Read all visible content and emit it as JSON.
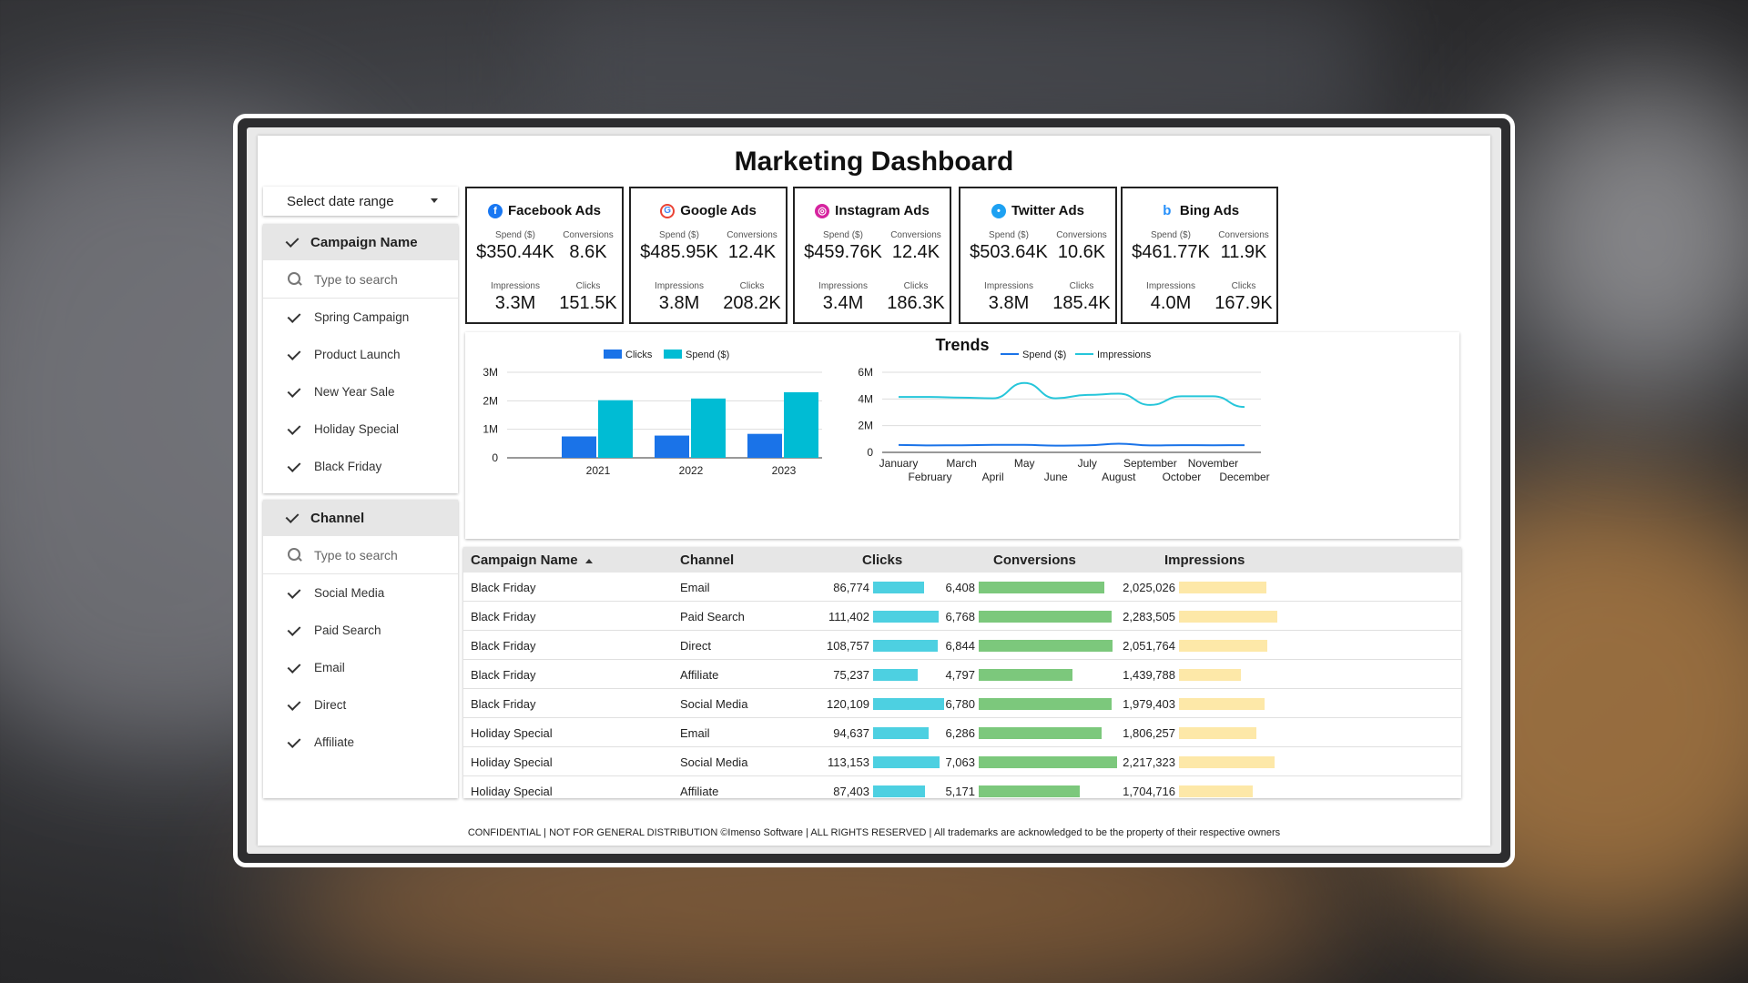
{
  "page_title": "Marketing Dashboard",
  "date_range": {
    "label": "Select date range"
  },
  "filters": {
    "campaign": {
      "title": "Campaign Name",
      "search_placeholder": "Type to search",
      "items": [
        "Spring Campaign",
        "Product Launch",
        "New Year Sale",
        "Holiday Special",
        "Black Friday"
      ]
    },
    "channel": {
      "title": "Channel",
      "search_placeholder": "Type to search",
      "items": [
        "Social Media",
        "Paid Search",
        "Email",
        "Direct",
        "Affiliate"
      ]
    }
  },
  "kpis": [
    {
      "name": "Facebook Ads",
      "icon": "facebook-icon",
      "color": "#1877f2",
      "spend_label": "Spend ($)",
      "spend": "$350.44K",
      "conv_label": "Conversions",
      "conversions": "8.6K",
      "imp_label": "Impressions",
      "impressions": "3.3M",
      "clicks_label": "Clicks",
      "clicks": "151.5K"
    },
    {
      "name": "Google Ads",
      "icon": "google-icon",
      "color": "#4285f4",
      "spend_label": "Spend ($)",
      "spend": "$485.95K",
      "conv_label": "Conversions",
      "conversions": "12.4K",
      "imp_label": "Impressions",
      "impressions": "3.8M",
      "clicks_label": "Clicks",
      "clicks": "208.2K"
    },
    {
      "name": "Instagram Ads",
      "icon": "instagram-icon",
      "color": "#d6249f",
      "spend_label": "Spend ($)",
      "spend": "$459.76K",
      "conv_label": "Conversions",
      "conversions": "12.4K",
      "imp_label": "Impressions",
      "impressions": "3.4M",
      "clicks_label": "Clicks",
      "clicks": "186.3K"
    },
    {
      "name": "Twitter Ads",
      "icon": "twitter-icon",
      "color": "#1da1f2",
      "spend_label": "Spend ($)",
      "spend": "$503.64K",
      "conv_label": "Conversions",
      "conversions": "10.6K",
      "imp_label": "Impressions",
      "impressions": "3.8M",
      "clicks_label": "Clicks",
      "clicks": "185.4K"
    },
    {
      "name": "Bing Ads",
      "icon": "bing-icon",
      "color": "#258ffa",
      "spend_label": "Spend ($)",
      "spend": "$461.77K",
      "conv_label": "Conversions",
      "conversions": "11.9K",
      "imp_label": "Impressions",
      "impressions": "4.0M",
      "clicks_label": "Clicks",
      "clicks": "167.9K"
    }
  ],
  "trends_title": "Trends",
  "chart_data": [
    {
      "type": "bar",
      "categories": [
        "2021",
        "2022",
        "2023"
      ],
      "series": [
        {
          "name": "Clicks",
          "color": "#1a73e8",
          "values": [
            750000,
            780000,
            840000
          ]
        },
        {
          "name": "Spend ($)",
          "color": "#00bcd4",
          "values": [
            2020000,
            2080000,
            2300000
          ]
        }
      ],
      "yticks": [
        "0",
        "1M",
        "2M",
        "3M"
      ],
      "ylim": [
        0,
        3000000
      ],
      "legend": "top"
    },
    {
      "type": "line",
      "categories": [
        "January",
        "February",
        "March",
        "April",
        "May",
        "June",
        "July",
        "August",
        "September",
        "October",
        "November",
        "December"
      ],
      "series": [
        {
          "name": "Spend ($)",
          "color": "#1a73e8",
          "values": [
            550000,
            520000,
            530000,
            560000,
            560000,
            500000,
            530000,
            650000,
            520000,
            540000,
            530000,
            540000
          ]
        },
        {
          "name": "Impressions",
          "color": "#26c6da",
          "values": [
            4150000,
            4150000,
            4100000,
            4050000,
            5200000,
            4050000,
            4300000,
            4400000,
            3550000,
            4200000,
            4200000,
            3400000
          ]
        }
      ],
      "yticks": [
        "0",
        "2M",
        "4M",
        "6M"
      ],
      "ylim": [
        0,
        6000000
      ],
      "legend": "top"
    }
  ],
  "table": {
    "headers": {
      "campaign": "Campaign Name",
      "channel": "Channel",
      "clicks": "Clicks",
      "conversions": "Conversions",
      "impressions": "Impressions"
    },
    "max": {
      "clicks": 120109,
      "conversions": 7063,
      "impressions": 2283505
    },
    "rows": [
      {
        "campaign": "Black Friday",
        "channel": "Email",
        "clicks": "86,774",
        "clicks_v": 86774,
        "conversions": "6,408",
        "conversions_v": 6408,
        "impressions": "2,025,026",
        "impressions_v": 2025026
      },
      {
        "campaign": "Black Friday",
        "channel": "Paid Search",
        "clicks": "111,402",
        "clicks_v": 111402,
        "conversions": "6,768",
        "conversions_v": 6768,
        "impressions": "2,283,505",
        "impressions_v": 2283505
      },
      {
        "campaign": "Black Friday",
        "channel": "Direct",
        "clicks": "108,757",
        "clicks_v": 108757,
        "conversions": "6,844",
        "conversions_v": 6844,
        "impressions": "2,051,764",
        "impressions_v": 2051764
      },
      {
        "campaign": "Black Friday",
        "channel": "Affiliate",
        "clicks": "75,237",
        "clicks_v": 75237,
        "conversions": "4,797",
        "conversions_v": 4797,
        "impressions": "1,439,788",
        "impressions_v": 1439788
      },
      {
        "campaign": "Black Friday",
        "channel": "Social Media",
        "clicks": "120,109",
        "clicks_v": 120109,
        "conversions": "6,780",
        "conversions_v": 6780,
        "impressions": "1,979,403",
        "impressions_v": 1979403
      },
      {
        "campaign": "Holiday Special",
        "channel": "Email",
        "clicks": "94,637",
        "clicks_v": 94637,
        "conversions": "6,286",
        "conversions_v": 6286,
        "impressions": "1,806,257",
        "impressions_v": 1806257
      },
      {
        "campaign": "Holiday Special",
        "channel": "Social Media",
        "clicks": "113,153",
        "clicks_v": 113153,
        "conversions": "7,063",
        "conversions_v": 7063,
        "impressions": "2,217,323",
        "impressions_v": 2217323
      },
      {
        "campaign": "Holiday Special",
        "channel": "Affiliate",
        "clicks": "87,403",
        "clicks_v": 87403,
        "conversions": "5,171",
        "conversions_v": 5171,
        "impressions": "1,704,716",
        "impressions_v": 1704716
      }
    ]
  },
  "footer": "CONFIDENTIAL | NOT FOR GENERAL DISTRIBUTION ©Imenso Software | ALL RIGHTS RESERVED | All trademarks are acknowledged to be the property of their respective owners"
}
